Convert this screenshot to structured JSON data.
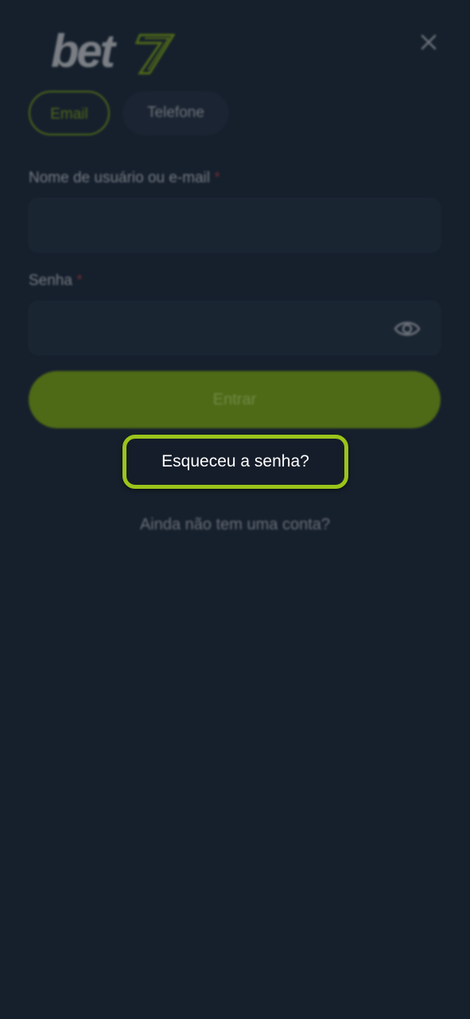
{
  "header": {
    "logo_text": "bet",
    "logo_suffix": "7",
    "close_icon": "close-icon"
  },
  "tabs": [
    {
      "label": "Email",
      "active": true
    },
    {
      "label": "Telefone",
      "active": false
    }
  ],
  "form": {
    "username_label": "Nome de usuário ou e-mail",
    "username_required": "*",
    "username_value": "",
    "password_label": "Senha",
    "password_required": "*",
    "password_value": "",
    "password_toggle_icon": "eye-icon"
  },
  "actions": {
    "login_label": "Entrar",
    "forgot_label": "Esqueceu a senha?",
    "signup_label": "Ainda não tem uma conta?"
  },
  "colors": {
    "background": "#16202d",
    "accent": "#9ac41a",
    "button_dimmed": "#4e6a16",
    "required": "#6a2d33"
  }
}
